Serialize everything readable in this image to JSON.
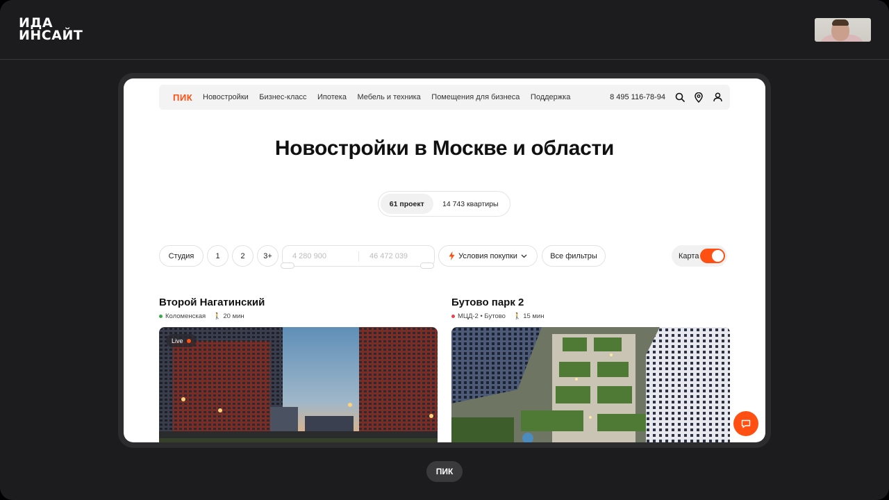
{
  "presentation": {
    "brand_line1": "ИДА",
    "brand_line2": "ИНСАЙТ",
    "caption": "ПИК"
  },
  "site": {
    "logo": "ПИК",
    "accent_color": "#ff4f12",
    "nav": [
      "Новостройки",
      "Бизнес-класс",
      "Ипотека",
      "Мебель и техника",
      "Помещения для бизнеса",
      "Поддержка"
    ],
    "phone": "8 495 116-78-94",
    "icons": [
      "search-icon",
      "location-pin-icon",
      "user-icon"
    ]
  },
  "hero": {
    "title": "Новостройки в Москве и области",
    "tabs": [
      {
        "label": "61 проект",
        "active": true
      },
      {
        "label": "14 743 квартиры",
        "active": false
      }
    ]
  },
  "filters": {
    "rooms": [
      "Студия",
      "1",
      "2",
      "3+"
    ],
    "price_min_placeholder": "4 280 900",
    "price_max_placeholder": "46 472 039",
    "purchase_terms": "Условия покупки",
    "all_filters": "Все фильтры",
    "map_label": "Карта",
    "map_enabled": true
  },
  "projects": [
    {
      "title": "Второй Нагатинский",
      "station": "Коломенская",
      "station_color": "#3aa84a",
      "walk_time": "20 мин",
      "badge": "Live"
    },
    {
      "title": "Бутово парк 2",
      "station": "МЦД-2 • Бутово",
      "station_color": "#e8424f",
      "walk_time": "15 мин",
      "badge": ""
    }
  ]
}
